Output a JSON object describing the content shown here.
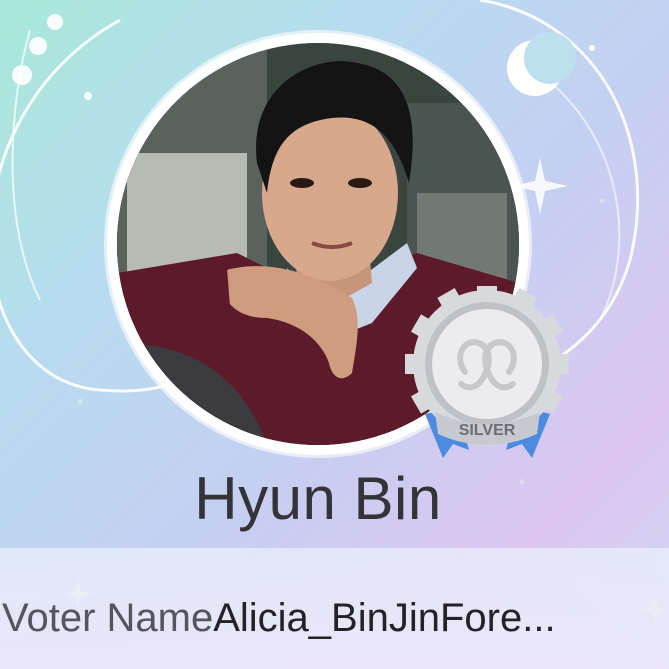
{
  "profile": {
    "name": "Hyun Bin",
    "badge_label": "SILVER",
    "badge_icon": "heart-ribbon-logo-icon"
  },
  "voter": {
    "label": "Voter Name",
    "value": "Alicia_BinJinFore..."
  },
  "colors": {
    "bg_start": "#a8e8d8",
    "bg_end": "#dcc6f0",
    "badge_silver": "#c9cbd0",
    "ribbon_blue": "#4d8be0",
    "name_text": "#333338"
  },
  "decorations": [
    "crescent-moon-icon",
    "sparkle-icon",
    "orbit-lines"
  ]
}
